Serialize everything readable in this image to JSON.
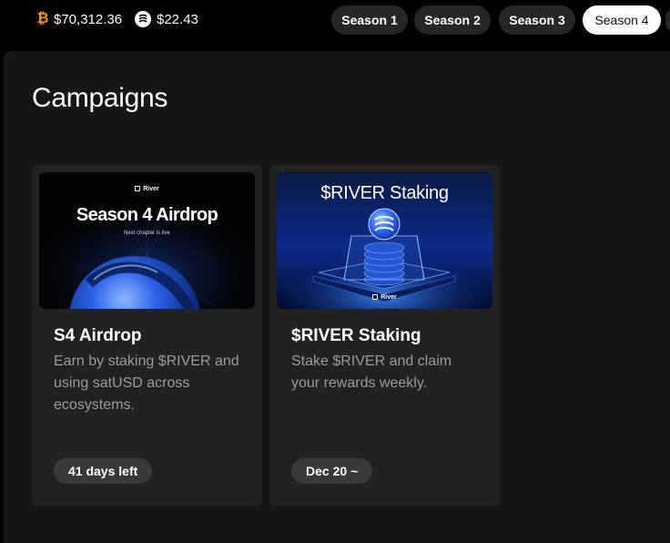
{
  "prices": {
    "btc": {
      "icon": "bitcoin-icon",
      "value": "$70,312.36"
    },
    "river": {
      "icon": "river-logo-icon",
      "value": "$22.43"
    }
  },
  "seasons": [
    {
      "label": "Season 1",
      "active": false
    },
    {
      "label": "Season 2",
      "active": false
    },
    {
      "label": "Season 3",
      "active": false
    },
    {
      "label": "Season 4",
      "active": true
    }
  ],
  "page": {
    "title": "Campaigns"
  },
  "campaigns": [
    {
      "thumb": {
        "brand": "River",
        "headline": "Season 4 Airdrop",
        "subline": "Next chapter is live"
      },
      "title": "S4 Airdrop",
      "description": "Earn by staking $RIVER and using satUSD across ecosystems.",
      "badge": "41 days left"
    },
    {
      "thumb": {
        "headline": "$RIVER Staking",
        "brand": "River"
      },
      "title": "$RIVER Staking",
      "description": "Stake $RIVER and claim your rewards weekly.",
      "badge": "Dec 20 ~"
    }
  ],
  "colors": {
    "background": "#000000",
    "panel": "#161616",
    "card": "#222222",
    "pill": "#262626",
    "pill_active": "#ffffff",
    "badge": "#393939",
    "muted_text": "#9a9a9a",
    "btc_orange": "#f7931a",
    "accent_blue": "#2f6bff"
  }
}
